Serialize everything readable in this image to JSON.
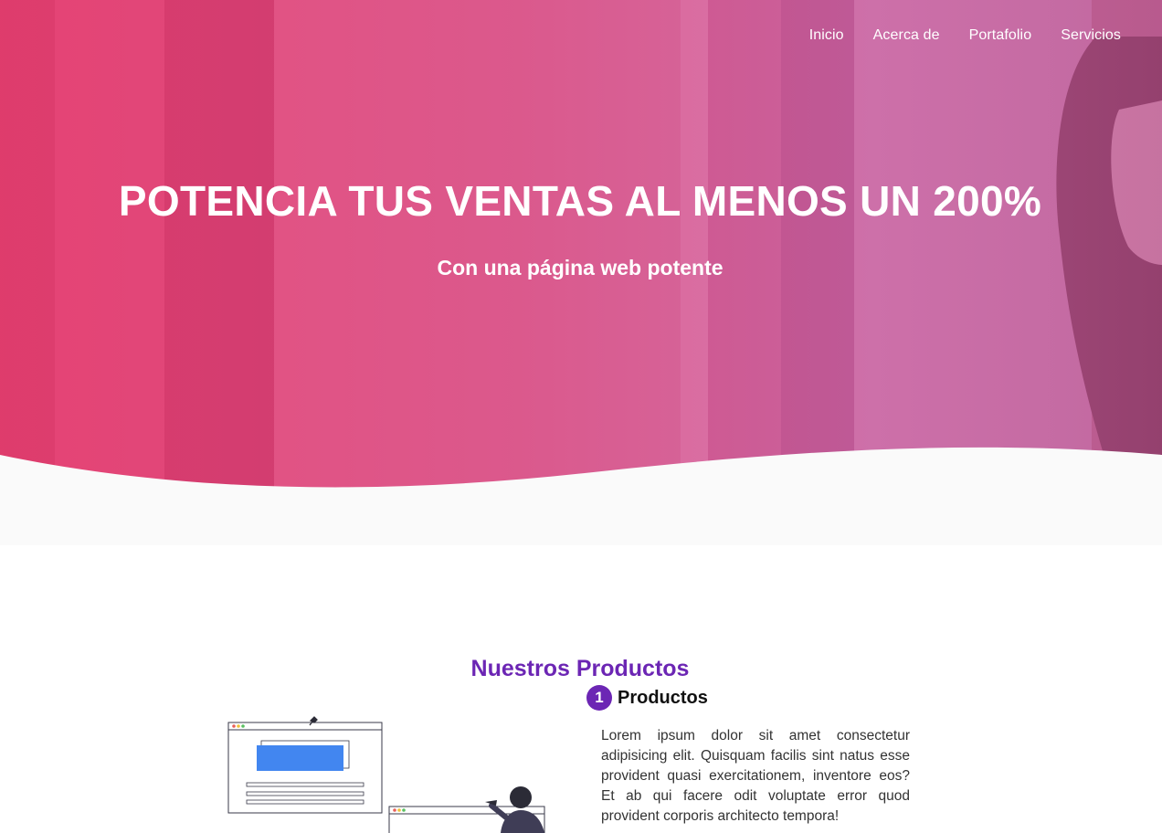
{
  "nav": {
    "items": [
      "Inicio",
      "Acerca de",
      "Portafolio",
      "Servicios"
    ]
  },
  "hero": {
    "title": "POTENCIA TUS VENTAS AL MENOS UN 200%",
    "subtitle": "Con una página web potente"
  },
  "products": {
    "section_title": "Nuestros Productos",
    "item_number": "1",
    "item_title": "Productos",
    "item_text": "Lorem ipsum dolor sit amet consectetur adipisicing elit. Quisquam facilis sint natus esse provident quasi exercitationem, inventore eos? Et ab qui facere odit voluptate error quod provident corporis architecto tempora!"
  },
  "colors": {
    "accent": "#6c26b4",
    "hero_pink": "#e93e70",
    "hero_text": "#ffffff"
  }
}
